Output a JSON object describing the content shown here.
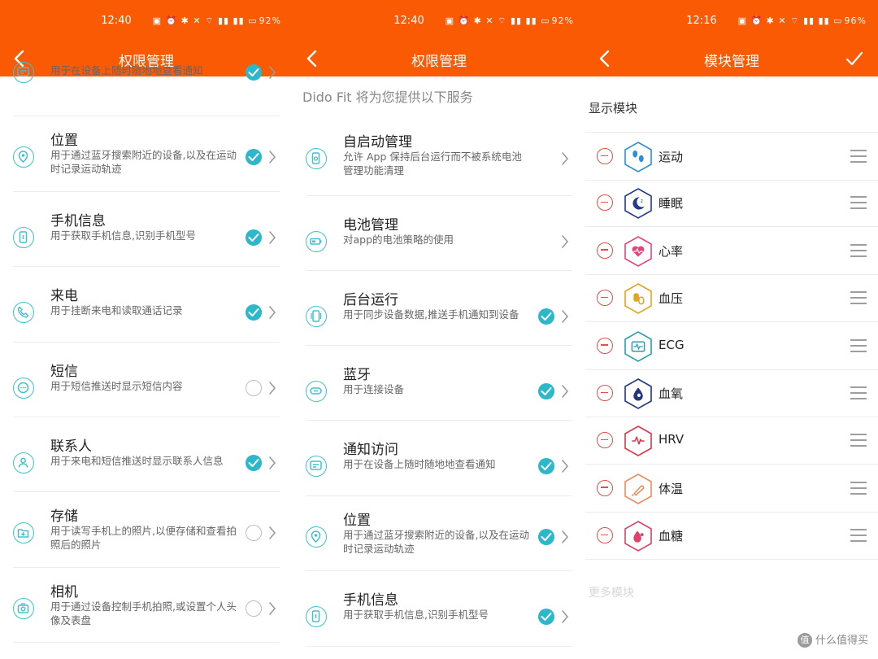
{
  "panel1": {
    "status": {
      "time": "12:40",
      "battery": "92%"
    },
    "title": "权限管理",
    "rows": [
      {
        "name": "",
        "desc": "用于在设备上随时随地地查看通知",
        "toggle": "on",
        "icon": "notification-icon"
      },
      {
        "name": "位置",
        "desc": "用于通过蓝牙搜索附近的设备,以及在运动时记录运动轨迹",
        "toggle": "on",
        "icon": "location-icon"
      },
      {
        "name": "手机信息",
        "desc": "用于获取手机信息,识别手机型号",
        "toggle": "on",
        "icon": "phone-info-icon"
      },
      {
        "name": "来电",
        "desc": "用于挂断来电和读取通话记录",
        "toggle": "on",
        "icon": "call-icon"
      },
      {
        "name": "短信",
        "desc": "用于短信推送时显示短信内容",
        "toggle": "off",
        "icon": "sms-icon"
      },
      {
        "name": "联系人",
        "desc": "用于来电和短信推送时显示联系人信息",
        "toggle": "on",
        "icon": "contact-icon"
      },
      {
        "name": "存储",
        "desc": "用于读写手机上的照片,以便存储和查看拍照后的照片",
        "toggle": "off",
        "icon": "storage-icon"
      },
      {
        "name": "相机",
        "desc": "用于通过设备控制手机拍照,或设置个人头像及表盘",
        "toggle": "off",
        "icon": "camera-icon"
      }
    ]
  },
  "panel2": {
    "status": {
      "time": "12:40",
      "battery": "92%"
    },
    "title": "权限管理",
    "intro": "Dido Fit 将为您提供以下服务",
    "rows": [
      {
        "name": "自启动管理",
        "desc": "允许 App 保持后台运行而不被系统电池管理功能清理",
        "toggle": "none",
        "icon": "autostart-icon"
      },
      {
        "name": "电池管理",
        "desc": "对app的电池策略的使用",
        "toggle": "none",
        "icon": "battery-icon"
      },
      {
        "name": "后台运行",
        "desc": "用于同步设备数据,推送手机通知到设备",
        "toggle": "on",
        "icon": "background-icon"
      },
      {
        "name": "蓝牙",
        "desc": "用于连接设备",
        "toggle": "on",
        "icon": "bluetooth-icon"
      },
      {
        "name": "通知访问",
        "desc": "用于在设备上随时随地地查看通知",
        "toggle": "on",
        "icon": "notification-icon"
      },
      {
        "name": "位置",
        "desc": "用于通过蓝牙搜索附近的设备,以及在运动时记录运动轨迹",
        "toggle": "on",
        "icon": "location-icon"
      },
      {
        "name": "手机信息",
        "desc": "用于获取手机信息,识别手机型号",
        "toggle": "on",
        "icon": "phone-info-icon"
      }
    ]
  },
  "panel3": {
    "status": {
      "time": "12:16",
      "battery": "96%"
    },
    "title": "模块管理",
    "section": "显示模块",
    "modules": [
      {
        "name": "运动",
        "color": "#2b8fd6",
        "icon": "footprints-icon"
      },
      {
        "name": "睡眠",
        "color": "#233a8f",
        "icon": "moon-icon"
      },
      {
        "name": "心率",
        "color": "#e4457d",
        "icon": "heart-icon"
      },
      {
        "name": "血压",
        "color": "#e7a21f",
        "icon": "blood-pressure-icon"
      },
      {
        "name": "ECG",
        "color": "#2a9fb0",
        "icon": "ecg-icon"
      },
      {
        "name": "血氧",
        "color": "#23367f",
        "icon": "blood-oxygen-icon"
      },
      {
        "name": "HRV",
        "color": "#d9354a",
        "icon": "hrv-icon"
      },
      {
        "name": "体温",
        "color": "#ee8a5b",
        "icon": "thermometer-icon"
      },
      {
        "name": "血糖",
        "color": "#e0406a",
        "icon": "blood-sugar-icon"
      }
    ],
    "more": "更多模块"
  },
  "watermark": "什么值得买",
  "colors": {
    "accent": "#fb5a05",
    "toggle_on": "#2cb7cb",
    "icon_line": "#3ec2d0",
    "remove": "#e04e4e"
  }
}
